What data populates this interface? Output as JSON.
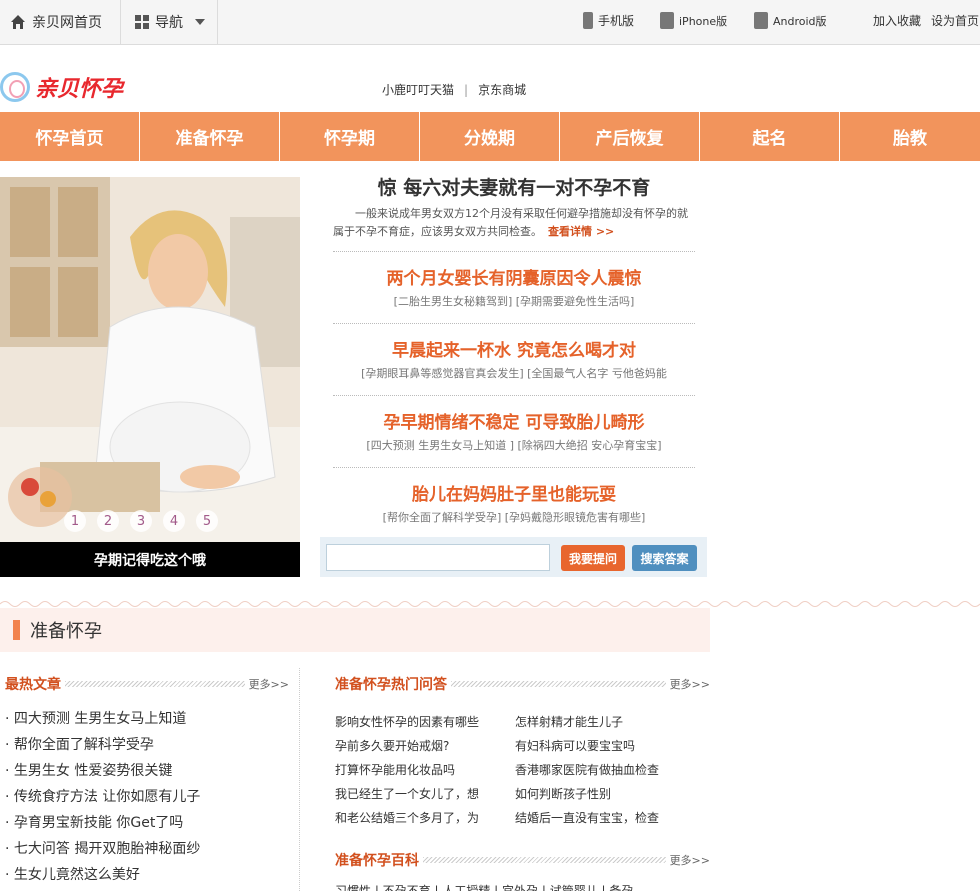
{
  "topbar": {
    "home": "亲贝网首页",
    "nav": "导航",
    "mobile": "手机版",
    "iphone": "iPhone版",
    "android": "Android版",
    "favorite": "加入收藏",
    "homepage": "设为首页"
  },
  "header": {
    "logo_text": "亲贝怀孕",
    "links": [
      "小鹿叮叮天猫",
      "京东商城"
    ]
  },
  "mainnav": [
    "怀孕首页",
    "准备怀孕",
    "怀孕期",
    "分娩期",
    "产后恢复",
    "起名",
    "胎教"
  ],
  "slideshow": {
    "caption": "孕期记得吃这个哦",
    "dots": [
      "1",
      "2",
      "3",
      "4",
      "5"
    ]
  },
  "lead": {
    "title": "惊 每六对夫妻就有一对不孕不育",
    "desc": "一般来说成年男女双方12个月没有采取任何避孕措施却没有怀孕的就属于不孕不育症，应该男女双方共同检查。",
    "more": "查看详情 >>"
  },
  "news": [
    {
      "title": "两个月女婴长有阴囊原因令人震惊",
      "sub": "[二胎生男生女秘籍驾到] [孕期需要避免性生活吗]"
    },
    {
      "title": "早晨起来一杯水 究竟怎么喝才对",
      "sub": "[孕期眼耳鼻等感觉器官真会发生] [全国最气人名字 亏他爸妈能"
    },
    {
      "title": "孕早期情绪不稳定 可导致胎儿畸形",
      "sub": "[四大预测 生男生女马上知道 ] [除祸四大绝招 安心孕育宝宝]"
    },
    {
      "title": "胎儿在妈妈肚子里也能玩耍",
      "sub": "[帮你全面了解科学受孕] [孕妈戴隐形眼镜危害有哪些]"
    }
  ],
  "search": {
    "placeholder": "",
    "ask_label": "我要提问",
    "search_label": "搜索答案"
  },
  "section": {
    "title": "准备怀孕"
  },
  "hot_articles": {
    "heading": "最热文章",
    "more": "更多>>",
    "items": [
      "四大预测 生男生女马上知道",
      "帮你全面了解科学受孕",
      "生男生女 性爱姿势很关键",
      "传统食疗方法 让你如愿有儿子",
      "孕育男宝新技能 你Get了吗",
      "七大问答 揭开双胞胎神秘面纱",
      "生女儿竟然这么美好"
    ]
  },
  "qa": {
    "heading": "准备怀孕热门问答",
    "more": "更多>>",
    "items": [
      "影响女性怀孕的因素有哪些",
      "怎样射精才能生儿子",
      "孕前多久要开始戒烟?",
      "有妇科病可以要宝宝吗",
      "打算怀孕能用化妆品吗",
      "香港哪家医院有做抽血检查",
      "我已经生了一个女儿了，想",
      "如何判断孩子性别",
      "和老公结婚三个多月了，为",
      "结婚后一直没有宝宝，检查"
    ]
  },
  "baike": {
    "heading": "准备怀孕百科",
    "more": "更多>>",
    "row": "习惯性 | 不孕不育 | 人工授精 | 宫外孕 | 试管婴儿 | 备孕"
  },
  "colors": {
    "nav_orange": "#f2945c",
    "accent_red": "#e5622a",
    "btn_orange": "#e8662e",
    "btn_blue": "#4f8fbf"
  }
}
